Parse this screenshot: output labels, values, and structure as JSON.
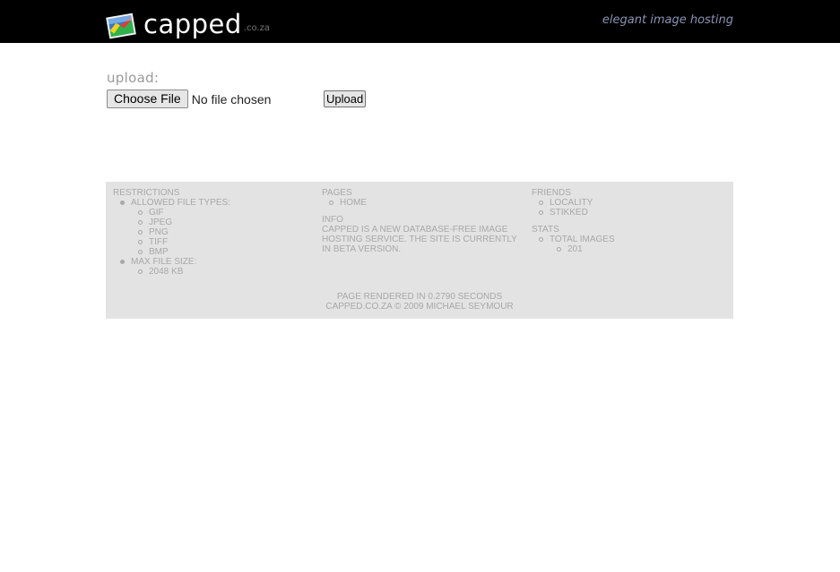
{
  "header": {
    "logo_text": "capped",
    "logo_tld": ".co.za",
    "tagline": "elegant image hosting"
  },
  "upload": {
    "heading": "upload:",
    "choose_label": "Choose File",
    "no_file_text": "No file chosen",
    "submit_label": "Upload"
  },
  "footer": {
    "restrictions": {
      "title": "RESTRICTIONS",
      "allowed_label": "ALLOWED FILE TYPES:",
      "types": [
        "GIF",
        "JPEG",
        "PNG",
        "TIFF",
        "BMP"
      ],
      "max_size_label": "MAX FILE SIZE:",
      "max_size_value": "2048 KB"
    },
    "pages": {
      "title": "PAGES",
      "items": [
        "HOME"
      ]
    },
    "info": {
      "title": "INFO",
      "text": "CAPPED IS A NEW DATABASE-FREE IMAGE HOSTING SERVICE. THE SITE IS CURRENTLY IN BETA VERSION."
    },
    "friends": {
      "title": "FRIENDS",
      "items": [
        "LOCALITY",
        "STIKKED"
      ]
    },
    "stats": {
      "title": "STATS",
      "total_images_label": "TOTAL IMAGES",
      "total_images_value": "201"
    },
    "rendered_text": "PAGE RENDERED IN 0.2790 SECONDS",
    "copyright_text": "CAPPED.CO.ZA © 2009 MICHAEL SEYMOUR"
  }
}
